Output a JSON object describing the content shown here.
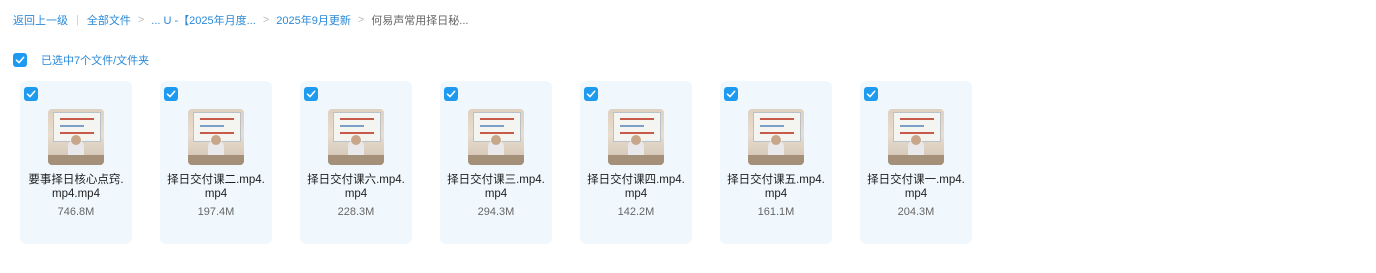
{
  "breadcrumb": {
    "back": "返回上一级",
    "divider": "|",
    "all_files": "全部文件",
    "sep": ">",
    "ellipsis_folder": "... U -【2025年月度...",
    "sept_update": "2025年9月更新",
    "current": "何易声常用择日秘..."
  },
  "selection": {
    "label": "已选中7个文件/文件夹"
  },
  "files": [
    {
      "name": "要事择日核心点窍.mp4.mp4",
      "size": "746.8M"
    },
    {
      "name": "择日交付课二.mp4.mp4",
      "size": "197.4M"
    },
    {
      "name": "择日交付课六.mp4.mp4",
      "size": "228.3M"
    },
    {
      "name": "择日交付课三.mp4.mp4",
      "size": "294.3M"
    },
    {
      "name": "择日交付课四.mp4.mp4",
      "size": "142.2M"
    },
    {
      "name": "择日交付课五.mp4.mp4",
      "size": "161.1M"
    },
    {
      "name": "择日交付课一.mp4.mp4",
      "size": "204.3M"
    }
  ],
  "colors": {
    "accent": "#1e9bf0",
    "link": "#2a89d8",
    "card_bg": "#f0f8fd"
  },
  "icons": {
    "checkbox": "checkmark-icon",
    "thumbnail": "video-thumbnail"
  }
}
